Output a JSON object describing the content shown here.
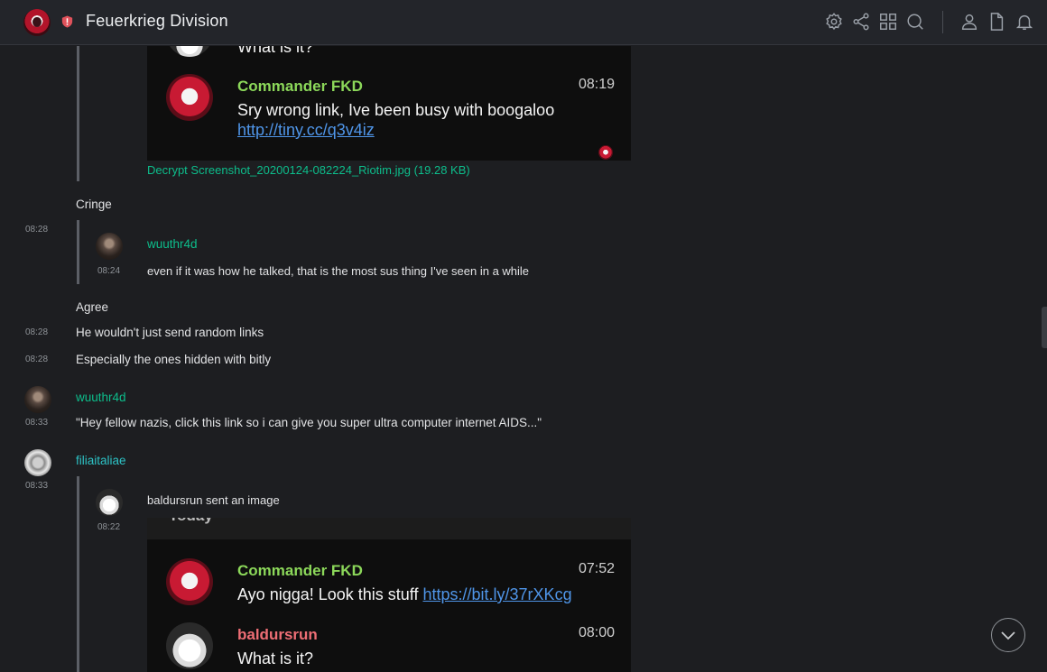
{
  "header": {
    "room_name": "Feuerkrieg Division",
    "icons": [
      "settings-icon",
      "share-icon",
      "apps-grid-icon",
      "search-icon",
      "people-icon",
      "files-icon",
      "notifications-icon"
    ]
  },
  "messages": {
    "quote1": {
      "shot_top_text": "What is it?",
      "shot_sender": "Commander FKD",
      "shot_time": "08:19",
      "shot_text": "Sry wrong link, Ive been busy with boogaloo",
      "shot_link": "http://tiny.cc/q3v4iz",
      "file_label": "Decrypt Screenshot_20200124-082224_Riotim.jpg (19.28 KB)"
    },
    "cringe": "Cringe",
    "quote2": {
      "outer_time": "08:28",
      "sender": "wuuthr4d",
      "time": "08:24",
      "text": "even if it was how he talked, that is the most sus thing I've seen in a while"
    },
    "agree": "Agree",
    "line1": {
      "time": "08:28",
      "text": "He wouldn't just send random links"
    },
    "line2": {
      "time": "08:28",
      "text": "Especially the ones hidden with bitly"
    },
    "wuuthr4d_msg": {
      "sender": "wuuthr4d",
      "time": "08:33",
      "text": "\"Hey fellow nazis, click this link so i can give you super ultra computer internet AIDS...\""
    },
    "filia_msg": {
      "sender": "filiaitaliae",
      "time": "08:33",
      "quote_time": "08:22",
      "quote_text": "baldursrun sent an image",
      "shot_header": "Today",
      "shot_sender1": "Commander FKD",
      "shot_time1": "07:52",
      "shot_text1": "Ayo nigga! Look this stuff",
      "shot_link1": "https://bit.ly/37rXKcg",
      "shot_sender2": "baldursrun",
      "shot_time2": "08:00",
      "shot_text2": "What is it?"
    }
  },
  "colors": {
    "accent_green": "#0dbd8b",
    "background": "#1d1e21"
  }
}
